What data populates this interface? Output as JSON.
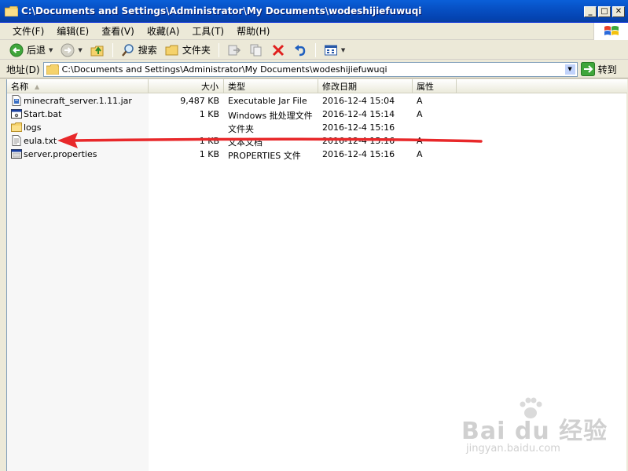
{
  "window": {
    "title": "C:\\Documents and Settings\\Administrator\\My Documents\\wodeshijiefuwuqi",
    "min": "_",
    "max": "□",
    "close": "✕"
  },
  "menu": [
    {
      "label": "文件(F)"
    },
    {
      "label": "编辑(E)"
    },
    {
      "label": "查看(V)"
    },
    {
      "label": "收藏(A)"
    },
    {
      "label": "工具(T)"
    },
    {
      "label": "帮助(H)"
    }
  ],
  "toolbar": {
    "back_label": "后退",
    "search_label": "搜索",
    "folders_label": "文件夹"
  },
  "address": {
    "label": "地址(D)",
    "value": "C:\\Documents and Settings\\Administrator\\My Documents\\wodeshijiefuwuqi",
    "go_label": "转到"
  },
  "columns": {
    "name": "名称",
    "size": "大小",
    "type": "类型",
    "modified": "修改日期",
    "attr": "属性"
  },
  "files": [
    {
      "name": "minecraft_server.1.11.jar",
      "size": "9,487 KB",
      "type": "Executable Jar File",
      "modified": "2016-12-4 15:04",
      "attr": "A",
      "icon": "jar-file-icon"
    },
    {
      "name": "Start.bat",
      "size": "1 KB",
      "type": "Windows 批处理文件",
      "modified": "2016-12-4 15:14",
      "attr": "A",
      "icon": "batch-file-icon"
    },
    {
      "name": "logs",
      "size": "",
      "type": "文件夹",
      "modified": "2016-12-4 15:16",
      "attr": "",
      "icon": "folder-icon"
    },
    {
      "name": "eula.txt",
      "size": "1 KB",
      "type": "文本文档",
      "modified": "2016-12-4 15:16",
      "attr": "A",
      "icon": "text-file-icon"
    },
    {
      "name": "server.properties",
      "size": "1 KB",
      "type": "PROPERTIES 文件",
      "modified": "2016-12-4 15:16",
      "attr": "A",
      "icon": "properties-file-icon"
    }
  ],
  "annotation": {
    "color": "#E8282A",
    "target": "eula.txt"
  },
  "watermark": {
    "main": "Bai du 经验",
    "sub": "jingyan.baidu.com"
  }
}
